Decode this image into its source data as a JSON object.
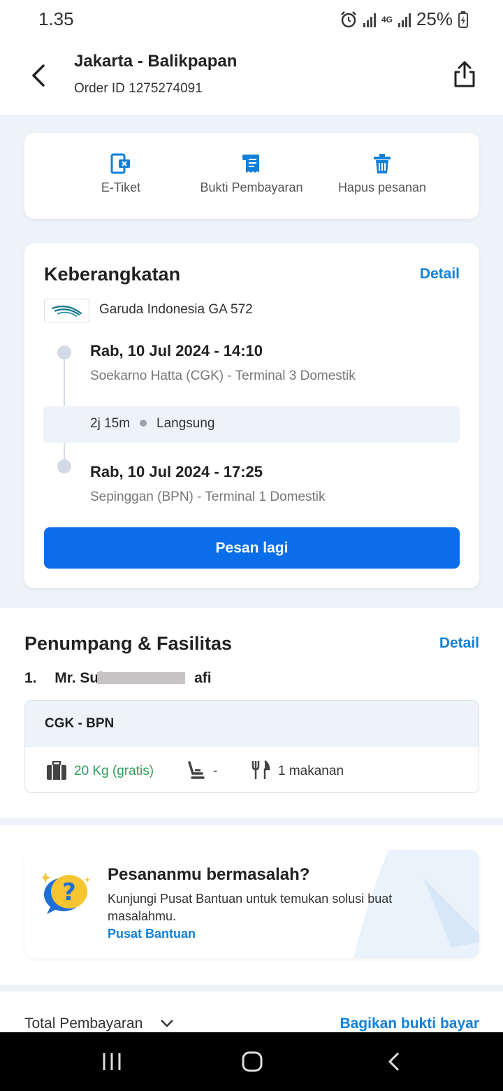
{
  "status_bar": {
    "time": "1.35",
    "network": "4G",
    "battery": "25%"
  },
  "header": {
    "title": "Jakarta - Balikpapan",
    "order_id": "Order ID 1275274091"
  },
  "actions": [
    {
      "label": "E-Tiket",
      "icon": "ticket-icon"
    },
    {
      "label": "Bukti Pembayaran",
      "icon": "receipt-icon"
    },
    {
      "label": "Hapus pesanan",
      "icon": "trash-icon"
    }
  ],
  "departure": {
    "title": "Keberangkatan",
    "detail_link": "Detail",
    "airline": "Garuda Indonesia GA 572",
    "depart_datetime": "Rab, 10 Jul 2024 - 14:10",
    "depart_airport": "Soekarno Hatta (CGK) - Terminal 3 Domestik",
    "duration": "2j 15m",
    "flight_type": "Langsung",
    "arrive_datetime": "Rab, 10 Jul 2024 - 17:25",
    "arrive_airport": "Sepinggan (BPN) - Terminal 1 Domestik",
    "rebook_button": "Pesan lagi"
  },
  "passengers": {
    "title": "Penumpang & Fasilitas",
    "detail_link": "Detail",
    "number": "1.",
    "name_prefix": "Mr. Sul",
    "name_suffix": "afi",
    "route": "CGK - BPN",
    "baggage": "20 Kg (gratis)",
    "seat": "-",
    "meal": "1 makanan",
    "colors": {
      "baggage_text": "#2E9E5B"
    }
  },
  "help": {
    "title": "Pesananmu bermasalah?",
    "description": "Kunjungi Pusat Bantuan untuk temukan solusi buat masalahmu.",
    "link": "Pusat Bantuan"
  },
  "footer": {
    "total_label": "Total Pembayaran",
    "share_proof": "Bagikan bukti bayar"
  },
  "colors": {
    "accent": "#1380D8",
    "primary_button": "#0A6EEB",
    "background": "#EEF3FA"
  }
}
